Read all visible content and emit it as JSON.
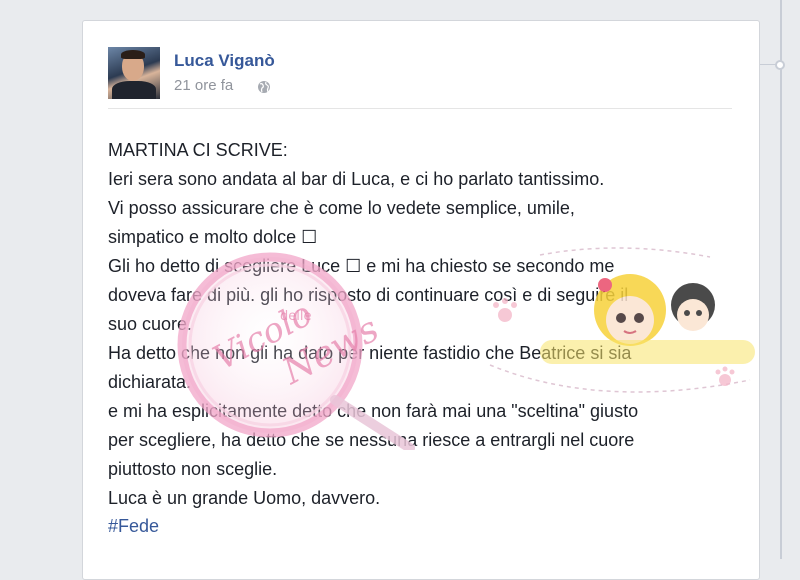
{
  "post": {
    "author_name": "Luca Viganò",
    "timestamp": "21 ore fa",
    "privacy_icon": "globe-icon",
    "text": "MARTINA CI SCRIVE:\nIeri sera sono andata al bar di Luca, e ci ho parlato tantissimo.\nVi posso assicurare che è come lo vedete semplice, umile,\nsimpatico e molto dolce ☐\nGli ho detto di scegliere Luce ☐ e mi ha chiesto se secondo me\ndoveva fare di più. gli ho risposto di continuare così e di seguire il\nsuo cuore.\nHa detto che non gli ha dato per niente fastidio che Beatrice si sia\ndichiarata.\ne mi ha esplicitamente detto che non farà mai una \"sceltina\" giusto\nper scegliere, ha detto che se nessuna riesce a entrargli nel cuore\npiuttosto non sceglie.\nLuca è un grande Uomo, davvero.",
    "hashtag": "#Fede"
  },
  "watermark": {
    "left_text": "Vicolo delle News"
  },
  "colors": {
    "link_blue": "#365899",
    "meta_gray": "#90949c",
    "text": "#1d2129",
    "page_bg": "#e9ebee"
  }
}
